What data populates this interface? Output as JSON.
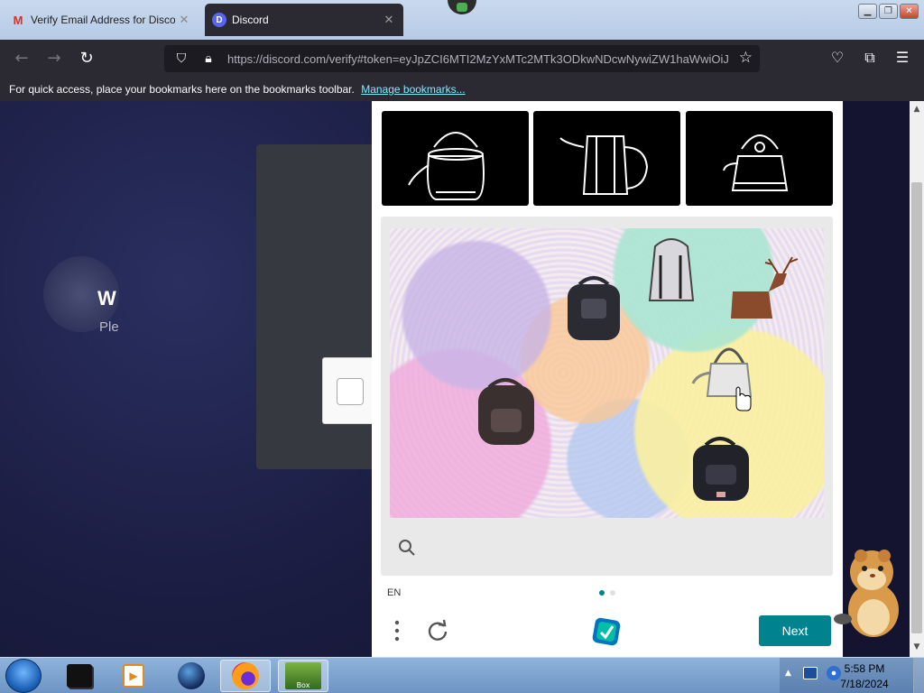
{
  "browser": {
    "tabs": [
      {
        "title": "Verify Email Address for Discord",
        "favicon": "M",
        "active": false
      },
      {
        "title": "Discord",
        "favicon": "D",
        "active": true
      }
    ],
    "url": "https://discord.com/verify#token=eyJpZCI6MTI2MzYxMTc2MTk3ODkwNDcwNywiZW1haWwiOiJ",
    "bookmarks_bar": {
      "message": "For quick access, place your bookmarks here on the bookmarks toolbar.",
      "link": "Manage bookmarks..."
    }
  },
  "page": {
    "heading_visible": "W",
    "subtitle_visible": "Ple"
  },
  "captcha": {
    "language": "EN",
    "next_label": "Next",
    "example_objects": [
      "kettle",
      "kettle",
      "kettle"
    ],
    "task_objects": [
      "backpack",
      "backpack",
      "backpack",
      "backpack",
      "deer",
      "kettle"
    ],
    "page_count": 2,
    "current_page": 1,
    "accent_color": "#00838f"
  },
  "taskbar": {
    "apps": [
      "terminal-icon",
      "media-player-icon",
      "globe-icon",
      "firefox-icon",
      "game-icon"
    ],
    "time": "5:58 PM",
    "date": "7/18/2024"
  }
}
